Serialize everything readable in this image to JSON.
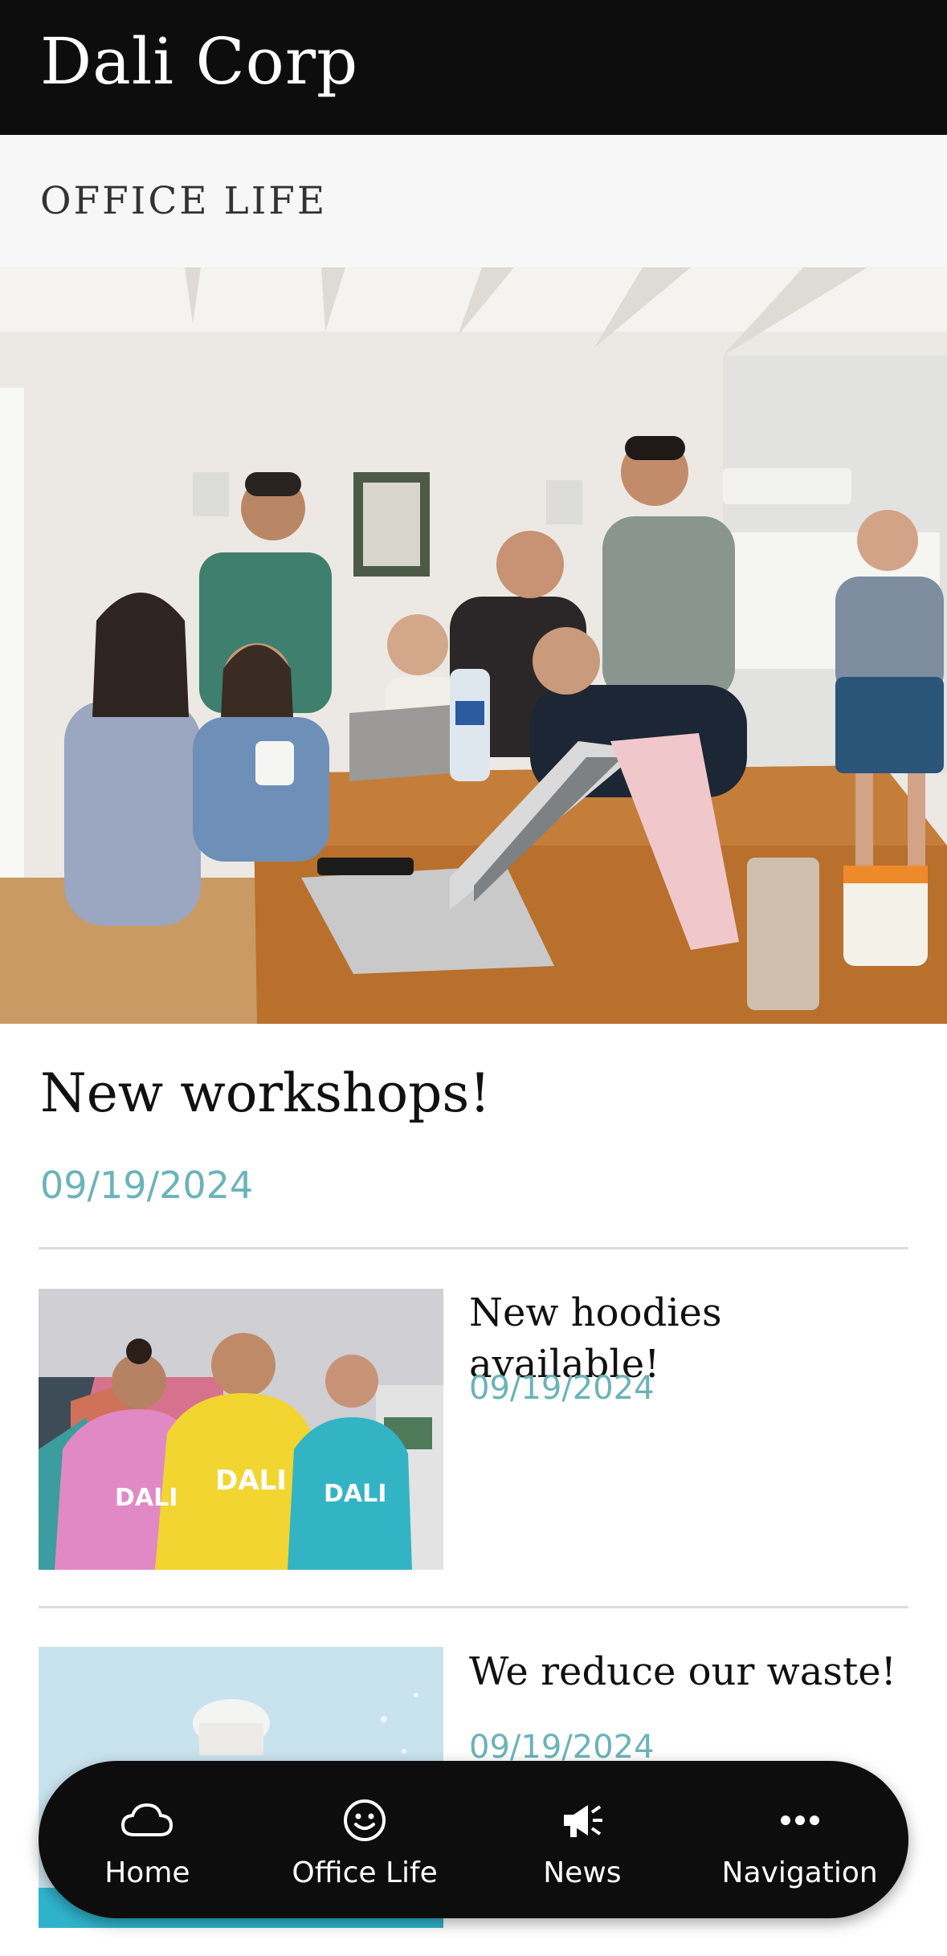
{
  "header": {
    "title": "Dali Corp"
  },
  "section": {
    "title": "OFFICE LIFE"
  },
  "featured": {
    "title": "New workshops!",
    "date": "09/19/2024",
    "image_icon": "team-meeting-photo"
  },
  "articles": [
    {
      "title": "New hoodies available!",
      "date": "09/19/2024",
      "image_icon": "hoodies-photo",
      "hoodie_text": "DALI"
    },
    {
      "title": "We reduce our waste!",
      "date": "09/19/2024",
      "image_icon": "coffee-cup-photo"
    }
  ],
  "nav": {
    "items": [
      {
        "label": "Home",
        "icon": "cloud-icon"
      },
      {
        "label": "Office Life",
        "icon": "smiley-icon"
      },
      {
        "label": "News",
        "icon": "megaphone-icon"
      },
      {
        "label": "Navigation",
        "icon": "more-dots-icon"
      }
    ]
  },
  "colors": {
    "header_bg": "#0d0d0d",
    "date_accent": "#6bb3b8",
    "section_bg": "#f7f7f7",
    "nav_bg": "#0d0d0d"
  }
}
